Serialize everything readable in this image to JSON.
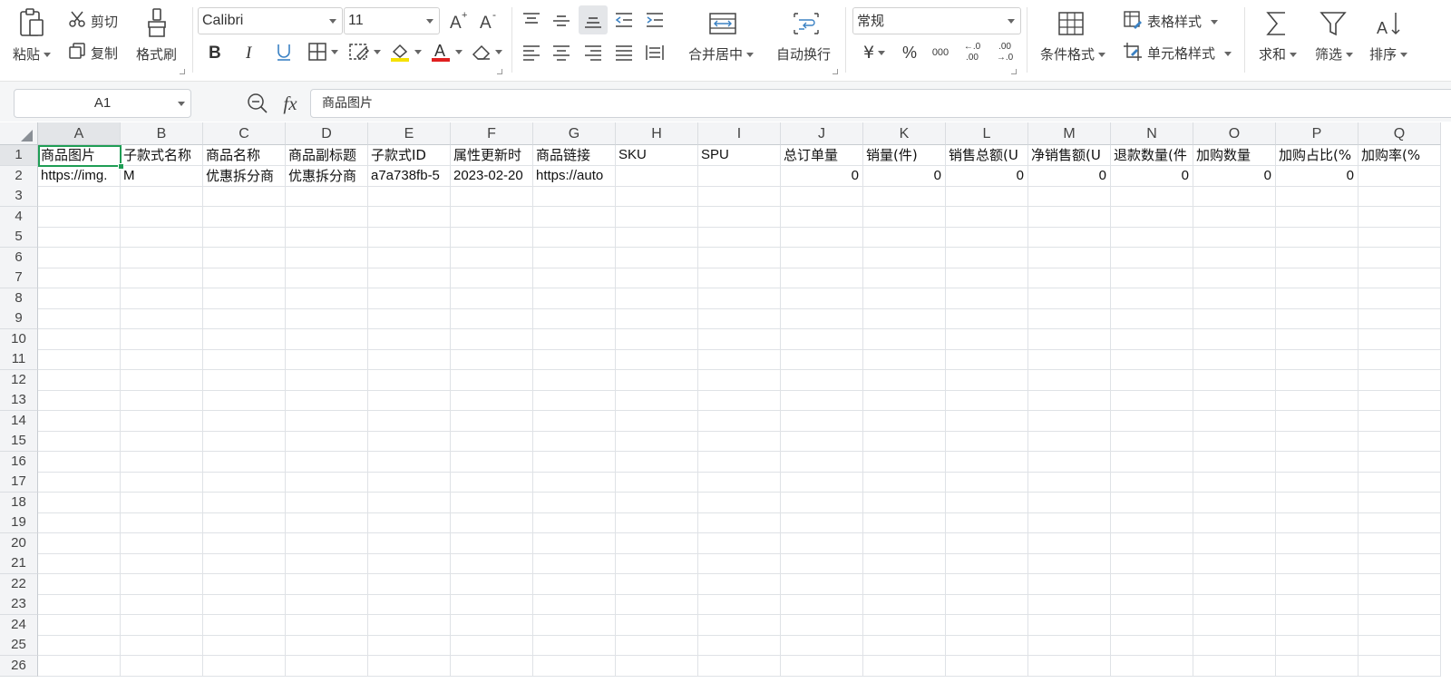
{
  "ribbon": {
    "paste": "粘贴",
    "cut": "剪切",
    "copy": "复制",
    "format_painter": "格式刷",
    "font_name": "Calibri",
    "font_size": "11",
    "merge_center": "合并居中",
    "wrap_text": "自动换行",
    "number_format": "常规",
    "conditional_format": "条件格式",
    "table_style": "表格样式",
    "cell_style": "单元格样式",
    "sum": "求和",
    "filter": "筛选",
    "sort": "排序",
    "currency_symbol": "¥",
    "percent_symbol": "%",
    "thousands_symbol": "000",
    "increase_decimal": "←.0 .00",
    "decrease_decimal": ".00 →.0"
  },
  "formula_bar": {
    "name_box": "A1",
    "fx": "fx",
    "content": "商品图片"
  },
  "sheet": {
    "selected_cell": "A1",
    "columns": [
      "A",
      "B",
      "C",
      "D",
      "E",
      "F",
      "G",
      "H",
      "I",
      "J",
      "K",
      "L",
      "M",
      "N",
      "O",
      "P",
      "Q"
    ],
    "row_count": 26,
    "header_row": [
      "商品图片",
      "子款式名称",
      "商品名称",
      "商品副标题",
      "子款式ID",
      "属性更新时",
      "商品链接",
      "SKU",
      "SPU",
      "总订单量",
      "销量(件)",
      "销售总额(U",
      "净销售额(U",
      "退款数量(件",
      "加购数量",
      "加购占比(%",
      "加购率(%"
    ],
    "data_row": [
      "https://img.",
      "M",
      "优惠拆分商",
      "优惠拆分商",
      "a7a738fb-5",
      "2023-02-20",
      "https://auto",
      "",
      "",
      "0",
      "0",
      "0",
      "0",
      "0",
      "0",
      "0",
      ""
    ]
  },
  "colors": {
    "selection": "#1f9d55",
    "header_bg": "#f3f4f6",
    "grid_line": "#dfe2e6"
  }
}
